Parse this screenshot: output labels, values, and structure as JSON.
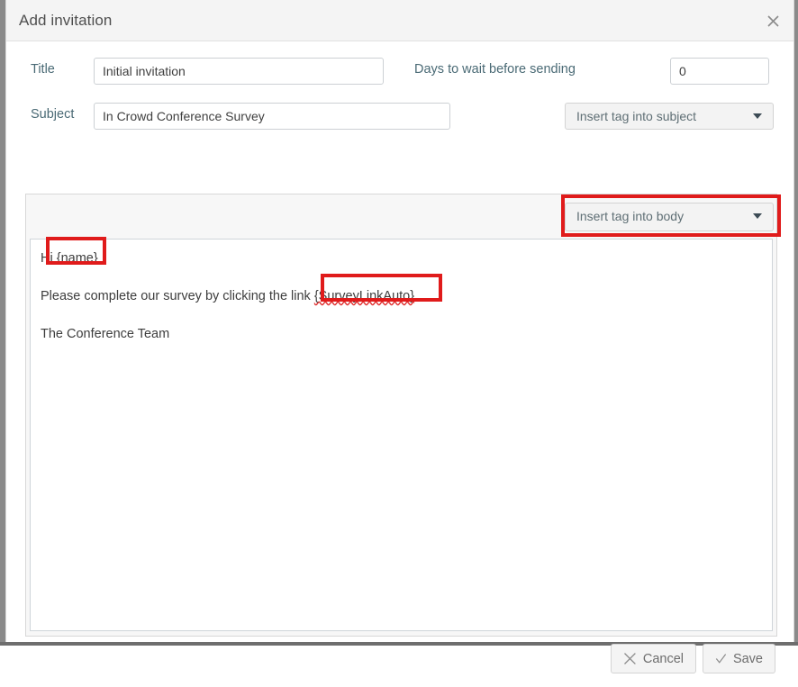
{
  "dialog": {
    "title": "Add invitation",
    "close_icon": "close-icon"
  },
  "form": {
    "title_label": "Title",
    "title_value": "Initial invitation",
    "title_placeholder": "",
    "days_label": "Days to wait before sending",
    "days_value": "0",
    "days_placeholder": "",
    "subject_label": "Subject",
    "subject_value": "In Crowd Conference Survey",
    "subject_placeholder": "",
    "subject_tag_select": "Insert tag into subject",
    "body_tag_select": "Insert tag into body",
    "caret_icon": "chevron-down-icon"
  },
  "editor": {
    "line1_prefix": "Hi ",
    "line1_tag": "{name}",
    "line2_prefix": "Please complete our survey by clicking the link ",
    "line2_tag": "{SurveyLinkAuto}",
    "line3": "The Conference Team"
  },
  "footer": {
    "cancel_label": "Cancel",
    "cancel_icon": "x-icon",
    "save_label": "Save",
    "save_icon": "check-icon"
  },
  "annotations": {
    "highlight_color": "#e01b1b",
    "boxes": [
      {
        "name": "name-tag-highlight",
        "target": "{name}"
      },
      {
        "name": "surveylink-tag-highlight",
        "target": "{SurveyLinkAuto}"
      },
      {
        "name": "insert-tag-into-body-highlight",
        "target": "Insert tag into body"
      }
    ]
  }
}
